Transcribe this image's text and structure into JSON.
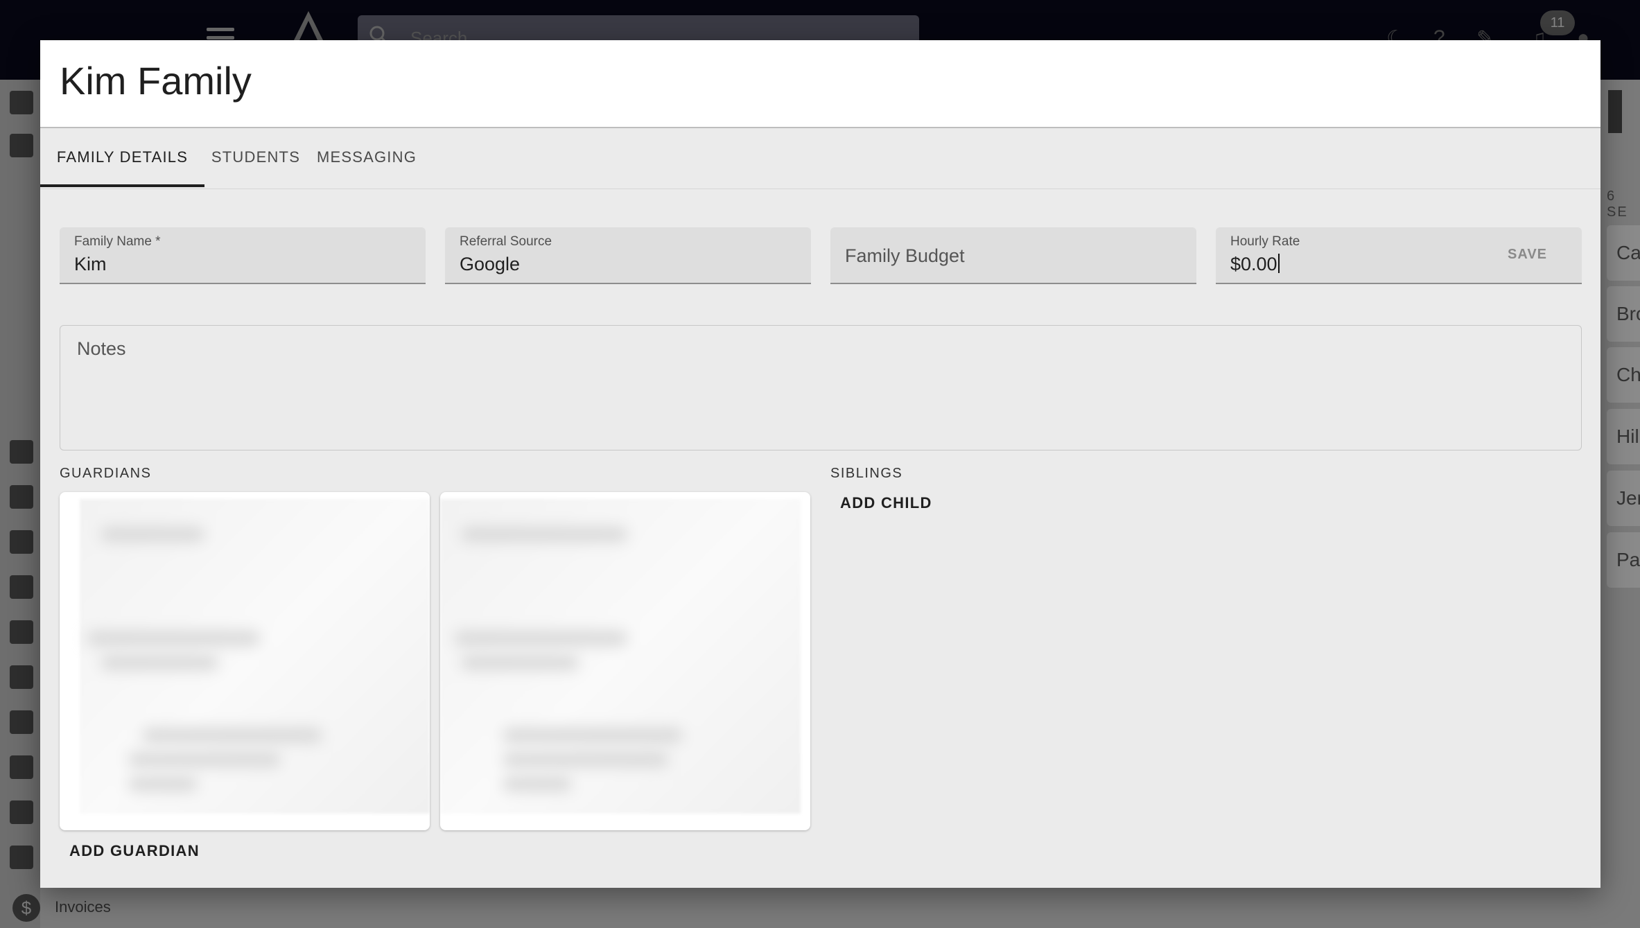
{
  "background": {
    "search_placeholder": "Search",
    "notification_count": "11",
    "sidebar_invoices_label": "Invoices",
    "right_panel_header": "6 SE",
    "right_panel_items": [
      "Ca",
      "Bro",
      "Ch",
      "Hil",
      "Jer",
      "Pa"
    ]
  },
  "dialog": {
    "title": "Kim Family",
    "tabs": [
      {
        "label": "FAMILY DETAILS",
        "active": true
      },
      {
        "label": "STUDENTS",
        "active": false
      },
      {
        "label": "MESSAGING",
        "active": false
      }
    ],
    "fields": {
      "family_name": {
        "label": "Family Name *",
        "value": "Kim"
      },
      "referral_source": {
        "label": "Referral Source",
        "value": "Google"
      },
      "family_budget": {
        "placeholder": "Family Budget"
      },
      "hourly_rate": {
        "label": "Hourly Rate",
        "value": "$0.00",
        "save_label": "SAVE"
      }
    },
    "notes": {
      "placeholder": "Notes"
    },
    "guardians": {
      "label": "GUARDIANS",
      "add_label": "ADD GUARDIAN"
    },
    "siblings": {
      "label": "SIBLINGS",
      "add_label": "ADD CHILD"
    }
  },
  "colors": {
    "topbar": "#05050f",
    "dialog_bg": "#ebebeb",
    "field_bg": "#dedede",
    "text_primary": "#1f1f1f"
  }
}
